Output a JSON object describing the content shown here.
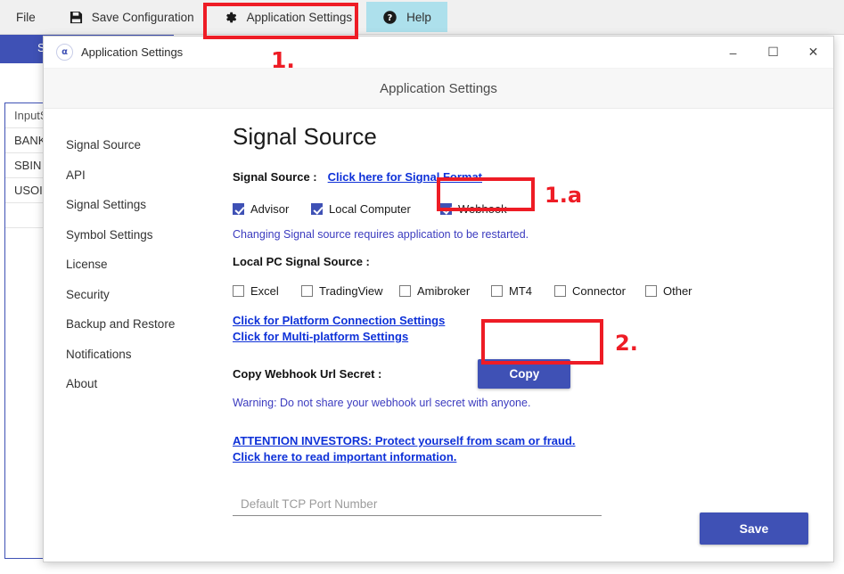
{
  "toolbar": {
    "file_label": "File",
    "save_config_label": "Save Configuration",
    "save_icon": "floppy-disk-icon",
    "app_settings_label": "Application Settings",
    "app_settings_icon": "gear-icon",
    "help_label": "Help",
    "help_icon": "question-circle-icon",
    "help_bg_color": "#ade0ec"
  },
  "background": {
    "band_text": "S",
    "band_color": "#3f51b5",
    "table": {
      "rows": [
        "InputS",
        "BANK",
        "SBIN",
        "USOIL",
        ""
      ]
    }
  },
  "dialog": {
    "app_icon": "alpha-icon",
    "icon_glyph": "α",
    "titlebar_title": "Application Settings",
    "subheader_title": "Application Settings",
    "window_controls": {
      "minimize": "–",
      "maximize": "☐",
      "close": "✕"
    },
    "nav": {
      "items": [
        {
          "label": "Signal Source"
        },
        {
          "label": "API"
        },
        {
          "label": "Signal Settings"
        },
        {
          "label": "Symbol Settings"
        },
        {
          "label": "License"
        },
        {
          "label": "Security"
        },
        {
          "label": "Backup and Restore"
        },
        {
          "label": "Notifications"
        },
        {
          "label": "About"
        }
      ]
    },
    "content": {
      "page_title": "Signal Source",
      "signal_source_label": "Signal Source :",
      "signal_format_link": "Click here for Signal Format",
      "source_checkboxes": [
        {
          "label": "Advisor",
          "checked": true
        },
        {
          "label": "Local Computer",
          "checked": true
        },
        {
          "label": "Webhook",
          "checked": true
        }
      ],
      "restart_note": "Changing Signal source requires application to be restarted.",
      "local_pc_label": "Local PC Signal Source :",
      "local_pc_checkboxes": [
        {
          "label": "Excel",
          "checked": false
        },
        {
          "label": "TradingView",
          "checked": false
        },
        {
          "label": "Amibroker",
          "checked": false
        },
        {
          "label": "MT4",
          "checked": false
        },
        {
          "label": "Connector",
          "checked": false
        },
        {
          "label": "Other",
          "checked": false
        }
      ],
      "platform_conn_link": "Click for Platform Connection Settings",
      "multiplatform_link": "Click for Multi-platform Settings",
      "copy_webhook_label": "Copy Webhook Url Secret :",
      "copy_button_label": "Copy",
      "webhook_warning": "Warning: Do not share your webhook url secret with anyone.",
      "investors_line1": "ATTENTION INVESTORS: Protect yourself from scam or fraud.",
      "investors_line2": "Click here to read important information.",
      "tcp_placeholder": "Default TCP Port Number",
      "tcp_value": "",
      "save_button_label": "Save"
    }
  },
  "annotations": {
    "marker_1": "1.",
    "marker_1a": "1.a",
    "marker_2": "2.",
    "highlight_color": "#ee1c25"
  }
}
